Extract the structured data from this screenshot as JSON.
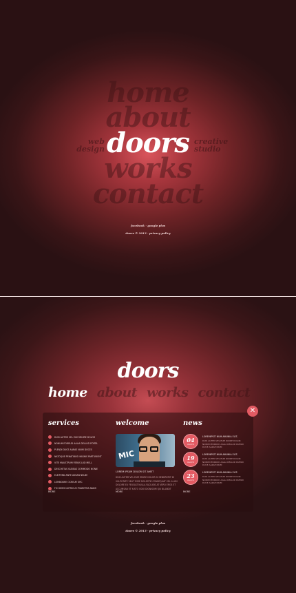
{
  "top": {
    "menu": [
      "home",
      "about",
      "doors",
      "works",
      "contact"
    ],
    "active": "doors",
    "side_left": [
      "web",
      "design"
    ],
    "side_right": [
      "creative",
      "studio"
    ],
    "social": "facebook · google plus",
    "copyright": "doors © 2013 · privacy policy"
  },
  "bottom": {
    "logo": "doors",
    "nav": [
      "home",
      "about",
      "works",
      "contact"
    ],
    "close_icon": "✕",
    "services": {
      "title": "services",
      "items": [
        "DUIS AUTEM VEL EUM IRIURE DOLOR",
        "NONUM EORRUD AALIA DELLUD PORTA",
        "PLENDI DUCE AARAE NIUM DOCES",
        "NATOQUE PENATIBUS MAGNIS PARTURIENT",
        "VITE MAUSTRUM FEBUS LUD MELL",
        "DESCHETAS SUDEAS COMMODO NONIE",
        "ELEIFEND ANTE ASSAN NELBE",
        "LOMBODRE OCREUR ORC",
        "FIC DEMS NUTRICUS PHARETRA NIAMI"
      ],
      "more": "MORE"
    },
    "welcome": {
      "title": "welcome",
      "photo_text": "MIC",
      "head": "LOREM IPSUM DOLOR SIT AMET",
      "text": "DUIS AUTEM VEL EUM IRIURE DOLOR IN HENDRERIT IN VULPUTATE VELIT ESSE MOLESTIE CONSEQUAT VEL ILLUM DOLORE EU FEUGIAT NULLA FACILISIS AT VERO EROS ET ACCUMSAN ET IUSTO ODIO DIGNISSIM QUI BLANDIT",
      "more": "MORE"
    },
    "news": {
      "title": "news",
      "items": [
        {
          "day": "04",
          "month": "march",
          "head": "LOREMIPSIT NUM AMUNIA ELIT..",
          "body": "DUIS AUTEM VEL EUM IRIURE DOLOR NONUM EORRUD AALIA DELLUD PLENDI DUCE AARAE NIUM"
        },
        {
          "day": "19",
          "month": "march",
          "head": "LOREMIPSIT NUM AMUNIA ELIT..",
          "body": "DUIS AUTEM VEL EUM IRIURE DOLOR NONUM EORRUD AALIA DELLUD PLENDI DUCE AARAE NIUM"
        },
        {
          "day": "23",
          "month": "march",
          "head": "LOREMIPSIT NUM AMUNIA ELIT..",
          "body": "DUIS AUTEM VEL EUM IRIURE DOLOR NONUM EORRUD AALIA DELLUD PLENDI DUCE AARAE NIUM"
        }
      ],
      "more": "MORE"
    },
    "social": "facebook · google plus",
    "copyright": "doors © 2013 · privacy policy"
  },
  "colors": {
    "accent": "#e35b63",
    "background_dark": "#2a1214",
    "menu_inactive": "#3c1214"
  }
}
